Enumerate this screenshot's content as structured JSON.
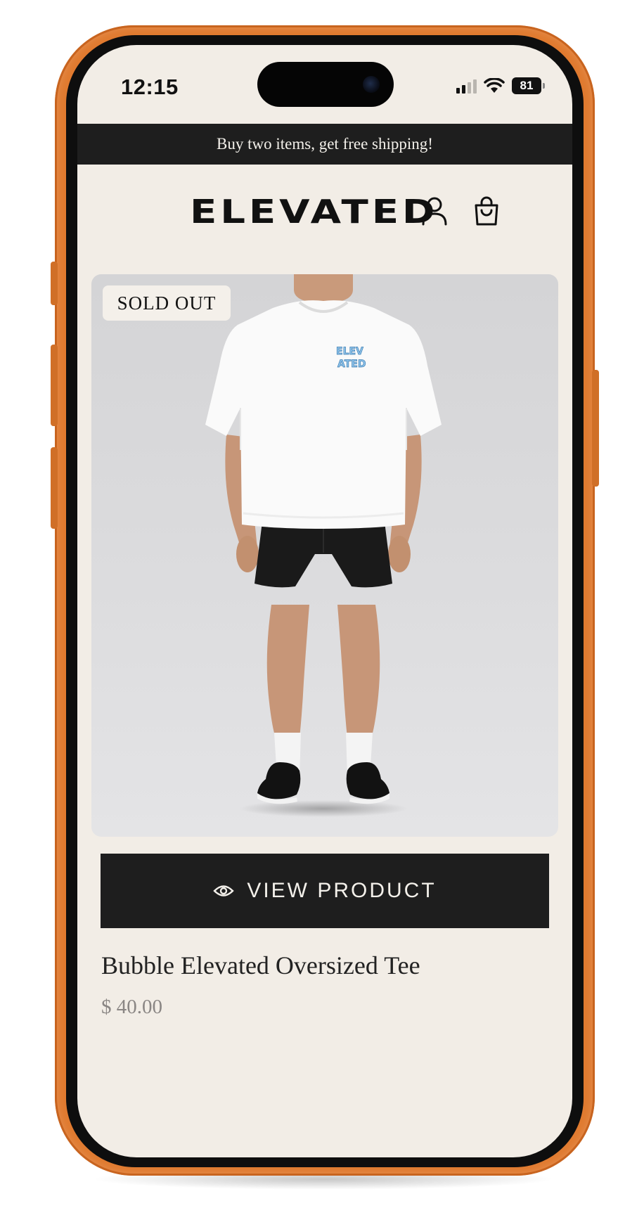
{
  "status_bar": {
    "time": "12:15",
    "battery": "81"
  },
  "promo": {
    "text": "Buy two items, get free shipping!"
  },
  "header": {
    "logo": "ELEVATED"
  },
  "product": {
    "badge": "SOLD OUT",
    "print_text": "ELEVATED",
    "cta_label": "VIEW PRODUCT",
    "title": "Bubble Elevated Oversized Tee",
    "price": "$ 40.00"
  },
  "colors": {
    "frame": "#e07a2f",
    "background": "#f2ede6",
    "dark": "#1e1e1e"
  },
  "icons": {
    "account": "user-icon",
    "cart": "shopping-bag-icon",
    "view": "eye-icon"
  }
}
